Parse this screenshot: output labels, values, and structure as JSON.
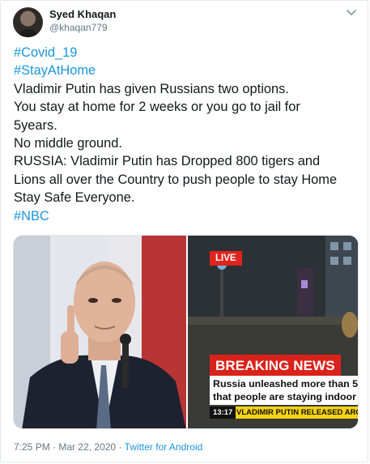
{
  "user": {
    "display_name": "Syed Khaqan",
    "handle": "@khaqan779"
  },
  "tweet": {
    "lines": [
      "#Covid_19",
      "#StayAtHome",
      "Vladimir Putin has given Russians two options.",
      "You stay at home for 2 weeks or you go to jail for",
      "5years.",
      "No middle ground.",
      "RUSSIA: Vladimir Putin has Dropped 800 tigers and",
      "Lions all over the Country to push people to stay Home",
      "Stay Safe Everyone.",
      "#NBC"
    ]
  },
  "media": {
    "live_label": "LIVE",
    "breaking_label": "BREAKING NEWS",
    "ticker_line1": "Russia unleashed more than 5",
    "ticker_line2": "that people are staying indoor",
    "timestamp": "13:17",
    "bottom_caption": "VLADIMIR PUTIN RELEASED AROUN"
  },
  "footer": {
    "time": "7:25 PM",
    "separator": "·",
    "date": "Mar 22, 2020",
    "client": "Twitter for Android"
  },
  "icons": {
    "menu": "chevron-down-icon"
  },
  "colors": {
    "link": "#1b95e0",
    "secondary_text": "#657786",
    "breaking_red": "#d9221b",
    "ticker_yellow": "#f5d214"
  }
}
